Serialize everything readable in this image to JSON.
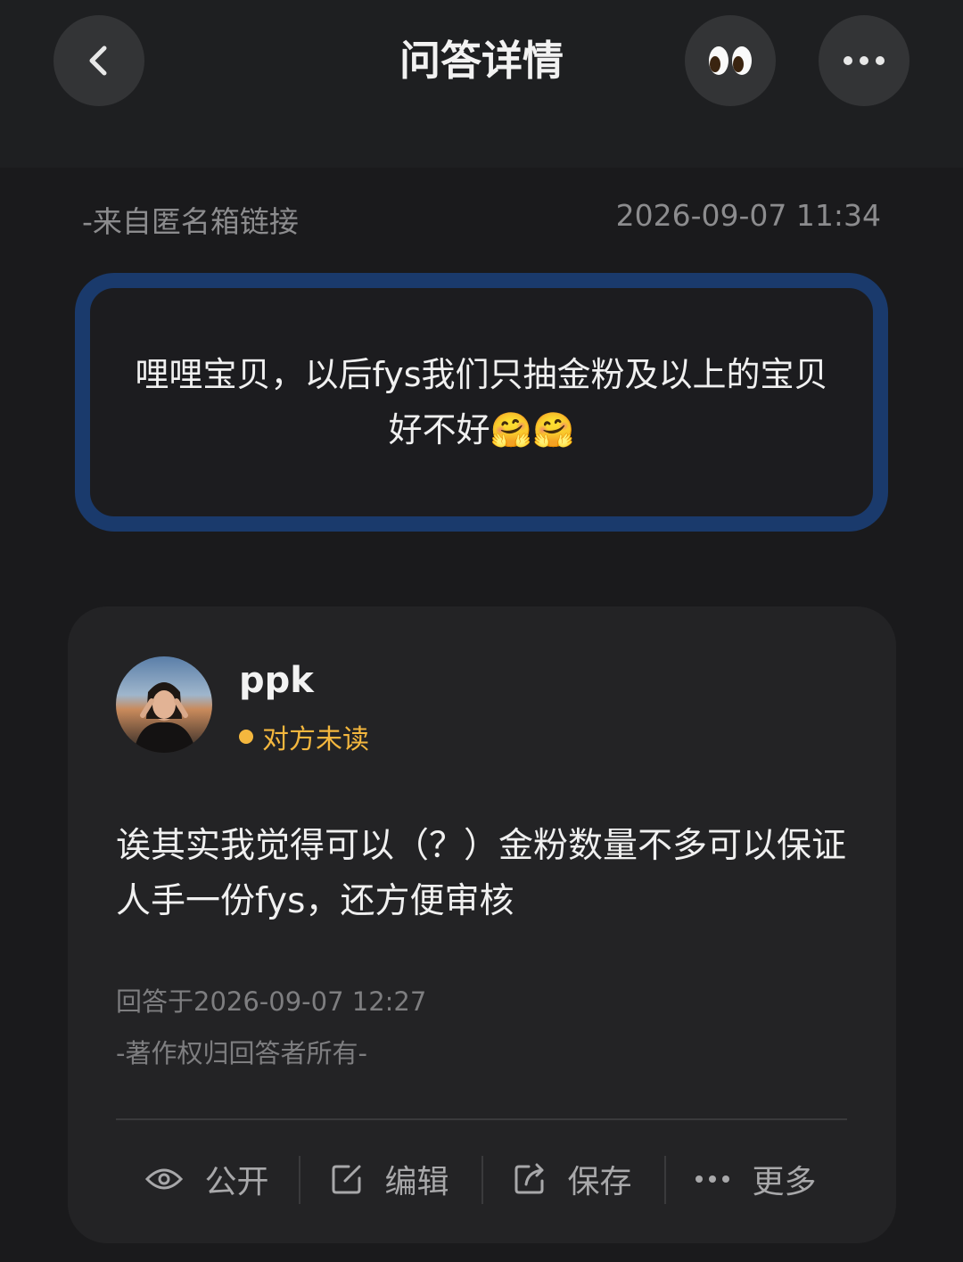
{
  "header": {
    "title": "问答详情",
    "back_icon": "chevron-left-icon",
    "eyes_icon": "eyes-emoji-icon",
    "more_icon": "more-dots-icon"
  },
  "question": {
    "source": "-来自匿名箱链接",
    "time": "2026-09-07 11:34",
    "text": "哩哩宝贝，以后fys我们只抽金粉及以上的宝贝好不好🤗🤗",
    "border_color": "#1a3a6c"
  },
  "answer": {
    "username": "ppk",
    "read_status": "对方未读",
    "status_color": "#f4b73e",
    "text": "诶其实我觉得可以（？）金粉数量不多可以保证人手一份fys，还方便审核",
    "answered_at": "回答于2026-09-07 12:27",
    "copyright": "-著作权归回答者所有-"
  },
  "actions": [
    {
      "icon": "eye-icon",
      "label": "公开"
    },
    {
      "icon": "edit-icon",
      "label": "编辑"
    },
    {
      "icon": "share-icon",
      "label": "保存"
    },
    {
      "icon": "more-dots-icon",
      "label": "更多"
    }
  ]
}
